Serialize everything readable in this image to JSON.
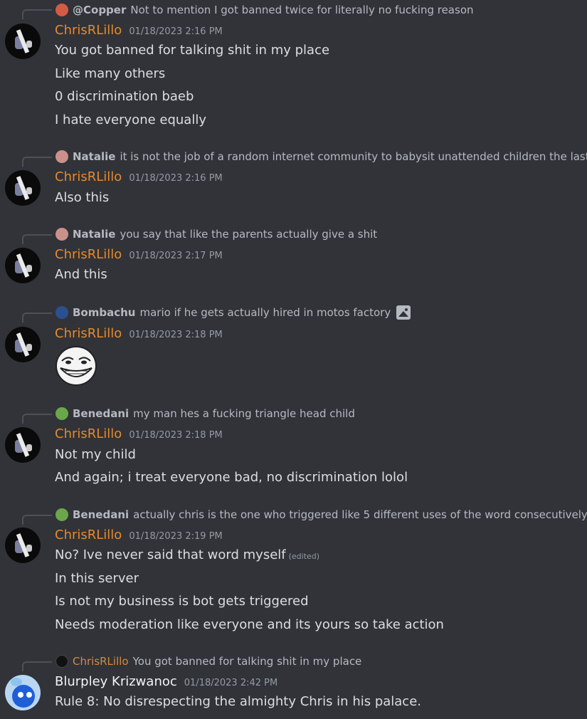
{
  "messages": [
    {
      "reply": {
        "author": "@Copper",
        "text": "Not to mention I got banned twice for literally no fucking reason",
        "avatar_color": "#d35b45"
      },
      "author": "ChrisRLillo",
      "timestamp": "01/18/2023 2:16 PM",
      "lines": [
        "You got banned for talking shit in my place",
        "Like many others",
        "0 discrimination baeb",
        "I hate everyone equally"
      ]
    },
    {
      "reply": {
        "author": "Natalie",
        "text": "it is not the job of a random internet community to babysit unattended children the last th",
        "avatar_color": "#c9918a"
      },
      "author": "ChrisRLillo",
      "timestamp": "01/18/2023 2:16 PM",
      "lines": [
        "Also this"
      ]
    },
    {
      "reply": {
        "author": "Natalie",
        "text": "you say that like the parents actually give a shit",
        "avatar_color": "#c9918a"
      },
      "author": "ChrisRLillo",
      "timestamp": "01/18/2023 2:17 PM",
      "lines": [
        "And this"
      ]
    },
    {
      "reply": {
        "author": "Bombachu",
        "text": "mario if he gets actually hired in motos factory",
        "avatar_color": "#2b4f8f",
        "attachment_icon": "image-icon"
      },
      "author": "ChrisRLillo",
      "timestamp": "01/18/2023 2:18 PM",
      "lines": [],
      "image": "trollface-image"
    },
    {
      "reply": {
        "author": "Benedani",
        "text": "my man hes a fucking triangle head child",
        "avatar_color": "#6aa64a"
      },
      "author": "ChrisRLillo",
      "timestamp": "01/18/2023 2:18 PM",
      "lines": [
        "Not my child",
        "And again; i treat everyone bad, no discrimination lolol"
      ]
    },
    {
      "reply": {
        "author": "Benedani",
        "text": "actually chris is the one who triggered like 5 different uses of the word consecutively",
        "avatar_color": "#6aa64a"
      },
      "author": "ChrisRLillo",
      "timestamp": "01/18/2023 2:19 PM",
      "lines": [
        "No? Ive never said that word myself",
        "In this server",
        "Is not my business is bot gets triggered",
        "Needs moderation like everyone and its yours so take action"
      ],
      "edited_label": "(edited)"
    },
    {
      "reply": {
        "author": "ChrisRLillo",
        "text": "You got banned for talking shit in my place",
        "avatar_color": "#111111"
      },
      "author": "Blurpley Krizwanoc",
      "timestamp": "01/18/2023 2:42 PM",
      "lines": [
        "Rule 8: No disrespecting the almighty Chris in his palace."
      ]
    }
  ],
  "colors": {
    "background": "#313338",
    "chris_name": "#e78a2a",
    "text": "#dbdee1",
    "muted": "#949ba4"
  }
}
